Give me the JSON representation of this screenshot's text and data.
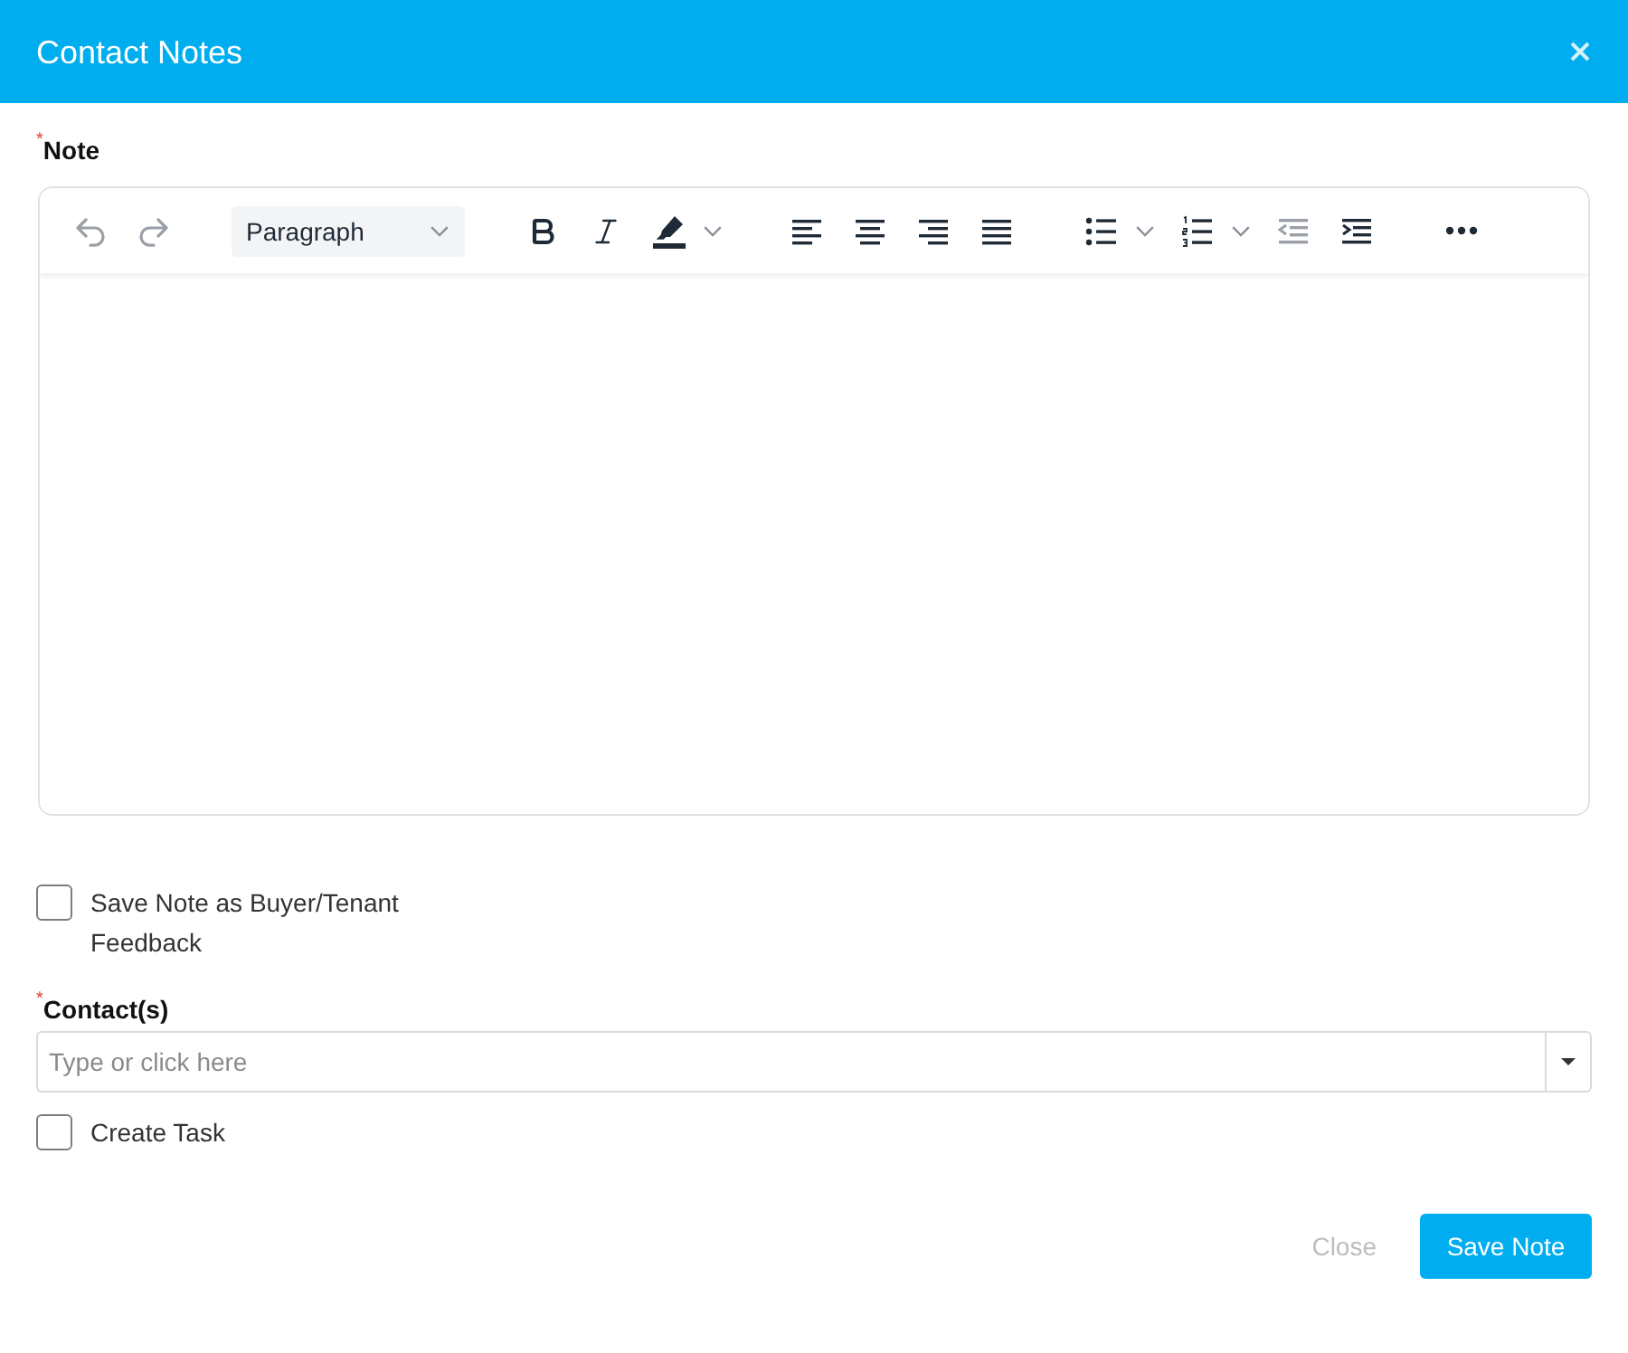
{
  "dialog": {
    "title": "Contact Notes"
  },
  "note": {
    "label": "Note",
    "required_mark": "*"
  },
  "editor": {
    "toolbar_groups": [
      {
        "items": [
          {
            "kind": "undo",
            "disabled": true,
            "has_dropdown": false
          },
          {
            "kind": "redo",
            "disabled": true,
            "has_dropdown": false
          }
        ]
      },
      {
        "items": [
          {
            "kind": "block-format",
            "value": "Paragraph",
            "disabled": false,
            "has_dropdown": true
          }
        ]
      },
      {
        "items": [
          {
            "kind": "bold",
            "disabled": false,
            "has_dropdown": false
          },
          {
            "kind": "italic",
            "disabled": false,
            "has_dropdown": false
          },
          {
            "kind": "highlight",
            "disabled": false,
            "has_dropdown": true
          }
        ]
      },
      {
        "items": [
          {
            "kind": "align-left",
            "disabled": false,
            "has_dropdown": false
          },
          {
            "kind": "align-center",
            "disabled": false,
            "has_dropdown": false
          },
          {
            "kind": "align-right",
            "disabled": false,
            "has_dropdown": false
          },
          {
            "kind": "align-justify",
            "disabled": false,
            "has_dropdown": false
          }
        ]
      },
      {
        "items": [
          {
            "kind": "bulleted-list",
            "disabled": false,
            "has_dropdown": true
          },
          {
            "kind": "numbered-list",
            "disabled": false,
            "has_dropdown": true
          },
          {
            "kind": "outdent",
            "disabled": true,
            "has_dropdown": false
          },
          {
            "kind": "indent",
            "disabled": false,
            "has_dropdown": false
          }
        ]
      },
      {
        "items": [
          {
            "kind": "more",
            "disabled": false,
            "has_dropdown": false
          }
        ]
      }
    ]
  },
  "feedback_option": {
    "label": "Save Note as Buyer/Tenant Feedback",
    "checked": false
  },
  "contacts": {
    "label": "Contact(s)",
    "required_mark": "*",
    "placeholder": "Type or click here"
  },
  "create_task": {
    "label": "Create Task",
    "checked": false
  },
  "buttons": [
    {
      "label": "Close",
      "kind": "secondary"
    },
    {
      "label": "Save Note",
      "kind": "primary"
    }
  ]
}
